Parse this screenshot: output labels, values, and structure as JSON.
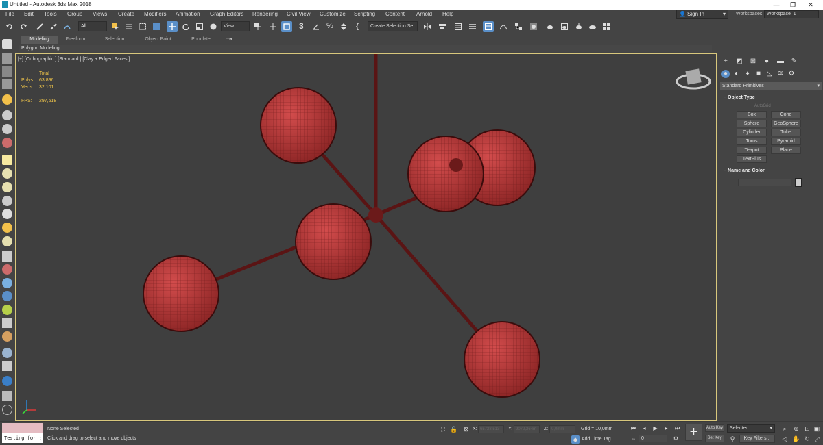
{
  "window": {
    "title": "Untitled - Autodesk 3ds Max 2018",
    "minimize": "—",
    "restore": "❐",
    "close": "✕"
  },
  "menu": [
    "File",
    "Edit",
    "Tools",
    "Group",
    "Views",
    "Create",
    "Modifiers",
    "Animation",
    "Graph Editors",
    "Rendering",
    "Civil View",
    "Customize",
    "Scripting",
    "Content",
    "Arnold",
    "Help"
  ],
  "account": {
    "signin": "Sign In",
    "workspaces_label": "Workspaces:",
    "workspace": "Workspace_1"
  },
  "toolbar": {
    "filter": "All",
    "refcoord": "View",
    "selection_set": "Create Selection Se",
    "snap_angle": "3"
  },
  "ribbon": {
    "tabs": [
      "Modeling",
      "Freeform",
      "Selection",
      "Object Paint",
      "Populate"
    ],
    "active_tab": "Modeling",
    "sub_label": "Polygon Modeling"
  },
  "viewport": {
    "label": "[+] [Orthographic ] [Standard ] [Clay + Edged Faces ]",
    "stats": {
      "total_label": "Total",
      "polys_label": "Polys:",
      "polys": "63 896",
      "verts_label": "Verts:",
      "verts": "32 101",
      "fps_label": "FPS:",
      "fps": "297,618"
    },
    "sphere_color": "#b23a3a",
    "rod_color": "#5a1414"
  },
  "command_panel": {
    "primitive_type": "Standard Primitives",
    "object_type_title": "Object Type",
    "autogrid": "AutoGrid",
    "buttons": [
      "Box",
      "Cone",
      "Sphere",
      "GeoSphere",
      "Cylinder",
      "Tube",
      "Torus",
      "Pyramid",
      "Teapot",
      "Plane",
      "TextPlus"
    ],
    "name_color_title": "Name and Color"
  },
  "status": {
    "script_text": "Testing for :",
    "selection": "None Selected",
    "hint": "Click and drag to select and move objects",
    "x_label": "X:",
    "x_value": "65728,513",
    "y_label": "Y:",
    "y_value": "9072,264m",
    "z_label": "Z:",
    "z_value": "0,0mm",
    "grid": "Grid = 10,0mm",
    "add_time_tag": "Add Time Tag",
    "frame": "0",
    "auto_key": "Auto Key",
    "set_key": "Set Key",
    "selected": "Selected",
    "key_filters": "Key Filters..."
  }
}
